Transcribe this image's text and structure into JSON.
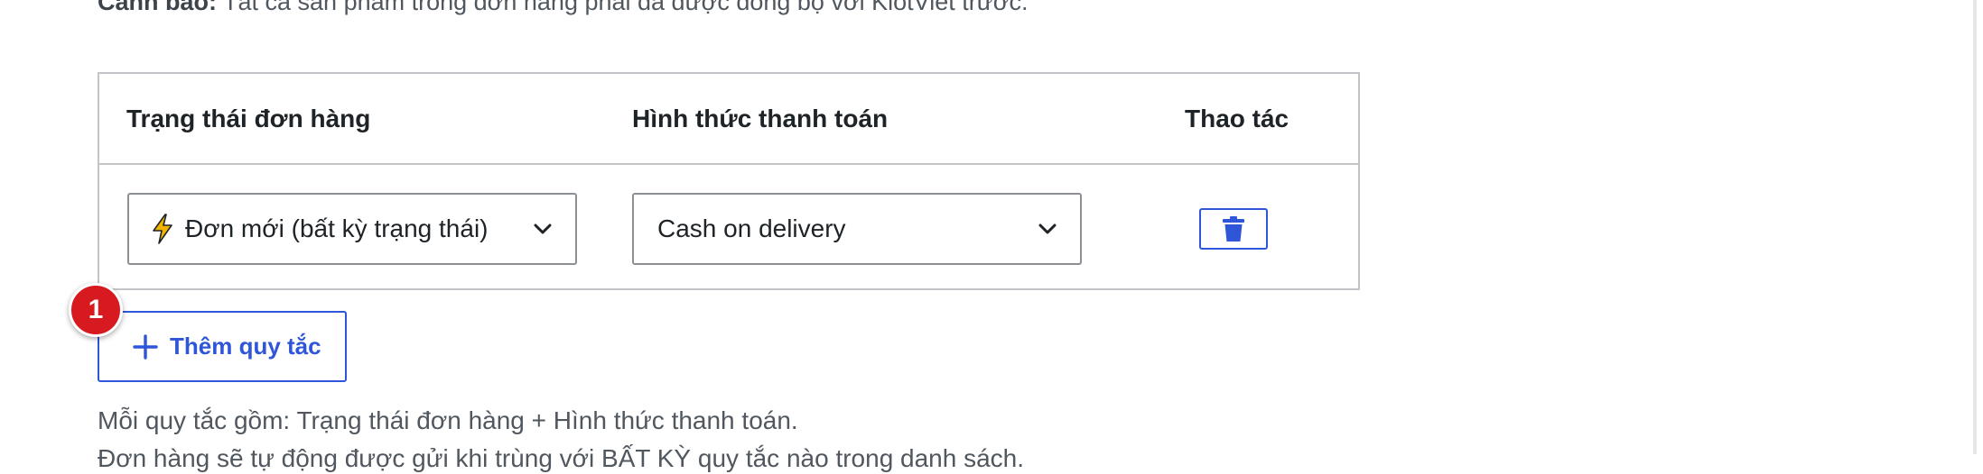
{
  "warning": {
    "label": "Cảnh báo:",
    "text": " Tất cả sản phẩm trong đơn hàng phải đã được đồng bộ với KiotViet trước."
  },
  "table": {
    "headers": {
      "status": "Trạng thái đơn hàng",
      "payment": "Hình thức thanh toán",
      "actions": "Thao tác"
    },
    "rows": [
      {
        "status_value": "Đơn mới (bất kỳ trạng thái)",
        "status_icon": "lightning-bolt-icon",
        "payment_value": "Cash on delivery",
        "action_icon": "trash-icon"
      }
    ]
  },
  "add_rule": {
    "label": "Thêm quy tắc",
    "icon": "plus-icon"
  },
  "step_badge": {
    "number": "1"
  },
  "help": {
    "line1": "Mỗi quy tắc gồm: Trạng thái đơn hàng + Hình thức thanh toán.",
    "line2": "Đơn hàng sẽ tự động được gửi khi trùng với BẤT KỲ quy tắc nào trong danh sách."
  },
  "colors": {
    "accent": "#2f56d8",
    "badge": "#d71920",
    "border": "#c3c4c7",
    "text": "#1d2327",
    "muted_text": "#50575e",
    "bolt": "#f0b400"
  }
}
